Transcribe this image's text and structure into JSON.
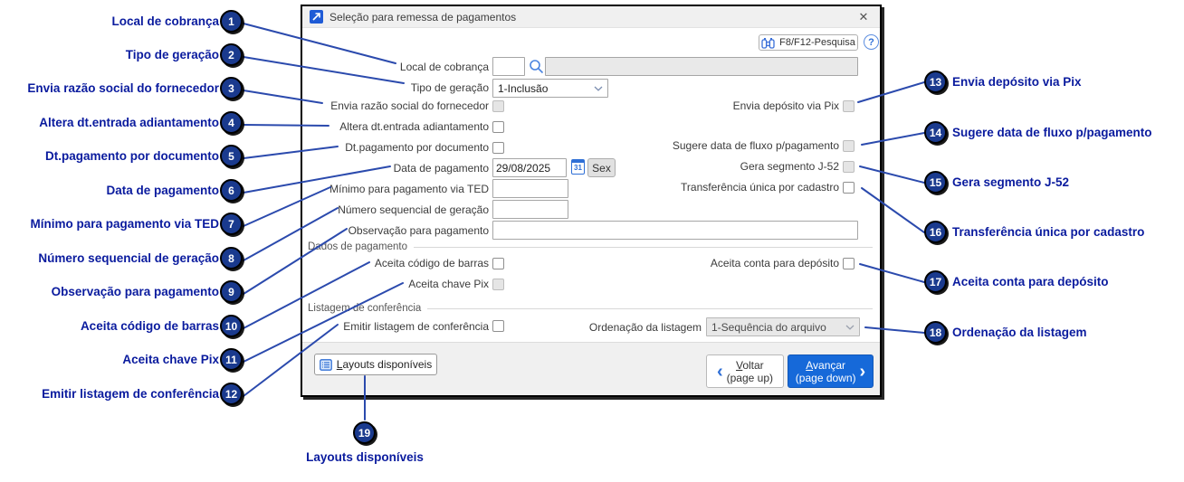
{
  "dialog": {
    "title": "Seleção para remessa de pagamentos",
    "close_glyph": "✕",
    "help_glyph": "?",
    "search_button_label": "F8/F12-Pesquisa",
    "rows": {
      "local_cobranca": {
        "label": "Local de cobrança",
        "code_value": "",
        "desc_value": ""
      },
      "tipo_geracao": {
        "label": "Tipo de geração",
        "value": "1-Inclusão"
      },
      "envia_razao": {
        "label": "Envia razão social do fornecedor"
      },
      "altera_dt": {
        "label": "Altera dt.entrada adiantamento"
      },
      "dt_pag_doc": {
        "label": "Dt.pagamento por documento"
      },
      "data_pagamento": {
        "label": "Data de pagamento",
        "value": "29/08/2025",
        "weekday": "Sex",
        "calendar_icon": "31"
      },
      "minimo_ted": {
        "label": "Mínimo para pagamento via TED",
        "value": ""
      },
      "num_seq": {
        "label": "Número sequencial de geração",
        "value": ""
      },
      "observacao": {
        "label": "Observação para pagamento",
        "value": ""
      },
      "envia_deposito_pix": {
        "label": "Envia depósito via Pix"
      },
      "sugere_fluxo": {
        "label": "Sugere data de fluxo p/pagamento"
      },
      "gera_j52": {
        "label": "Gera segmento J-52"
      },
      "transf_unica": {
        "label": "Transferência única por cadastro"
      },
      "aceita_barras": {
        "label": "Aceita código de barras"
      },
      "aceita_chave_pix": {
        "label": "Aceita chave Pix"
      },
      "aceita_conta": {
        "label": "Aceita conta para depósito"
      },
      "emitir_listagem": {
        "label": "Emitir listagem de conferência"
      },
      "ordenacao": {
        "label": "Ordenação da listagem",
        "value": "1-Sequência do arquivo"
      }
    },
    "groups": {
      "dados_pagamento": "Dados de pagamento",
      "listagem_conferencia": "Listagem de conferência"
    },
    "footer": {
      "layouts": "Layouts disponíveis",
      "voltar": "Voltar",
      "voltar_sub": "(page up)",
      "avancar": "Avançar",
      "avancar_sub": "(page down)"
    }
  },
  "callouts": {
    "left": [
      {
        "num": "1",
        "label": "Local de cobrança"
      },
      {
        "num": "2",
        "label": "Tipo de geração"
      },
      {
        "num": "3",
        "label": "Envia razão social do fornecedor"
      },
      {
        "num": "4",
        "label": "Altera dt.entrada adiantamento"
      },
      {
        "num": "5",
        "label": "Dt.pagamento por documento"
      },
      {
        "num": "6",
        "label": "Data de pagamento"
      },
      {
        "num": "7",
        "label": "Mínimo para pagamento via TED"
      },
      {
        "num": "8",
        "label": "Número sequencial de geração"
      },
      {
        "num": "9",
        "label": "Observação para pagamento"
      },
      {
        "num": "10",
        "label": "Aceita código de barras"
      },
      {
        "num": "11",
        "label": "Aceita chave Pix"
      },
      {
        "num": "12",
        "label": "Emitir listagem de conferência"
      }
    ],
    "right": [
      {
        "num": "13",
        "label": "Envia depósito via Pix"
      },
      {
        "num": "14",
        "label": "Sugere data de fluxo p/pagamento"
      },
      {
        "num": "15",
        "label": "Gera segmento J-52"
      },
      {
        "num": "16",
        "label": "Transferência única por cadastro"
      },
      {
        "num": "17",
        "label": "Aceita conta para depósito"
      },
      {
        "num": "18",
        "label": "Ordenação da listagem"
      }
    ],
    "bottom": [
      {
        "num": "19",
        "label": "Layouts disponíveis"
      }
    ]
  },
  "colors": {
    "accent_blue": "#1669d9",
    "annotation_blue": "#0a1b9e",
    "badge_navy": "#1a3a8e",
    "line_blue": "#2b4aad",
    "titlebar_gray": "#f0f0f0",
    "disabled_gray": "#e9e9e9"
  }
}
